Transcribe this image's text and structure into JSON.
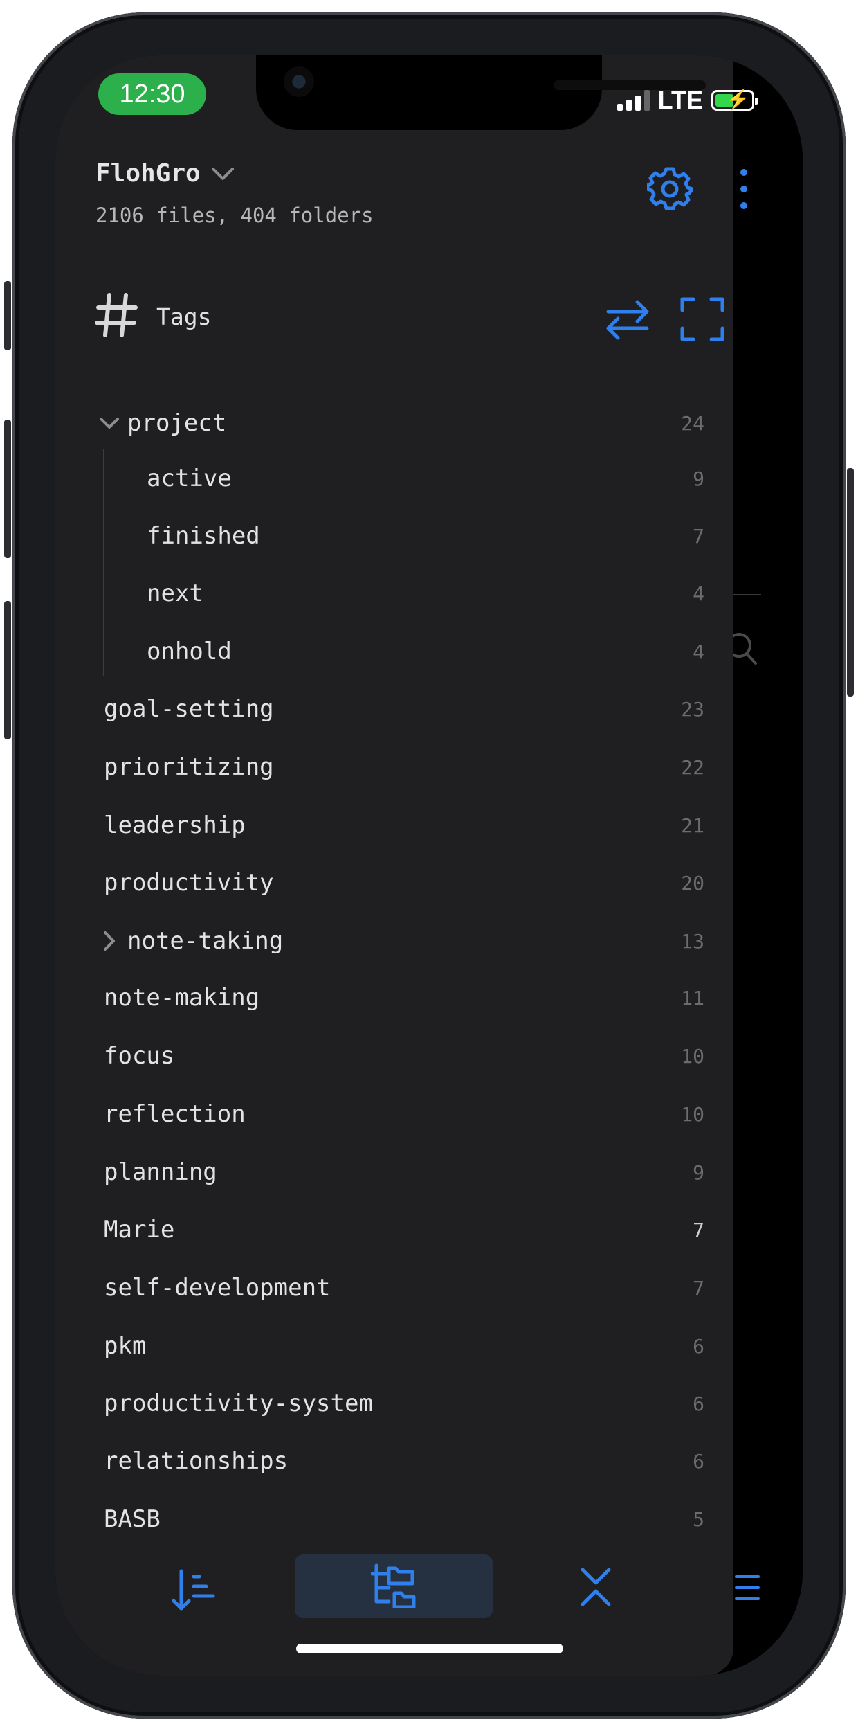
{
  "status_bar": {
    "time": "12:30",
    "network": "LTE"
  },
  "vault": {
    "name": "FlohGro",
    "summary": "2106 files, 404 folders"
  },
  "icons": {
    "settings": "gear-icon",
    "more": "more-vertical-icon",
    "tags": "hash-icon",
    "swap": "swap-arrows-icon",
    "expand": "fullscreen-icon",
    "sort": "sort-icon",
    "tree": "folder-tree-icon",
    "collapse": "collapse-icon",
    "menu": "menu-icon",
    "search": "search-icon"
  },
  "tags_panel": {
    "title": "Tags",
    "items": [
      {
        "name": "project",
        "count": "24"
      },
      {
        "name": "active",
        "count": "9"
      },
      {
        "name": "finished",
        "count": "7"
      },
      {
        "name": "next",
        "count": "4"
      },
      {
        "name": "onhold",
        "count": "4"
      },
      {
        "name": "goal-setting",
        "count": "23"
      },
      {
        "name": "prioritizing",
        "count": "22"
      },
      {
        "name": "leadership",
        "count": "21"
      },
      {
        "name": "productivity",
        "count": "20"
      },
      {
        "name": "note-taking",
        "count": "13"
      },
      {
        "name": "note-making",
        "count": "11"
      },
      {
        "name": "focus",
        "count": "10"
      },
      {
        "name": "reflection",
        "count": "10"
      },
      {
        "name": "planning",
        "count": "9"
      },
      {
        "name": "Marie",
        "count": "7"
      },
      {
        "name": "self-development",
        "count": "7"
      },
      {
        "name": "pkm",
        "count": "6"
      },
      {
        "name": "productivity-system",
        "count": "6"
      },
      {
        "name": "relationships",
        "count": "6"
      },
      {
        "name": "BASB",
        "count": "5"
      }
    ]
  },
  "colors": {
    "accent": "#2f80ed",
    "background": "#1f1f21",
    "text": "#e3e3e3",
    "muted": "#6c6c6c",
    "battery": "#32d74b",
    "time_pill": "#2bb04c"
  }
}
